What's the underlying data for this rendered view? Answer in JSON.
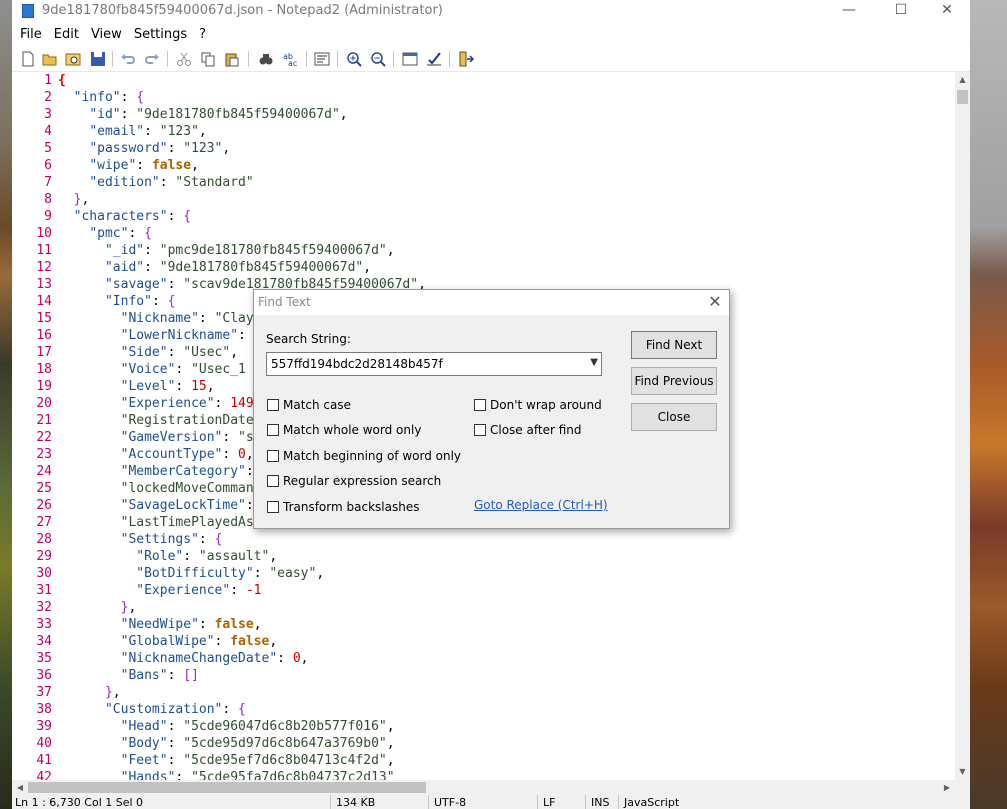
{
  "window": {
    "title": "9de181780fb845f59400067d.json - Notepad2 (Administrator)",
    "controls": {
      "minimize": "—",
      "maximize": "☐",
      "close": "✕"
    }
  },
  "menu": [
    "File",
    "Edit",
    "View",
    "Settings",
    "?"
  ],
  "toolbar": [
    "new-icon",
    "open-icon",
    "browse-icon",
    "save-icon",
    "undo-icon",
    "redo-icon",
    "cut-icon",
    "copy-icon",
    "paste-icon",
    "find-icon",
    "replace-icon",
    "word-wrap-icon",
    "zoom-in-icon",
    "zoom-out-icon",
    "scheme-icon",
    "customize-icon",
    "exit-icon"
  ],
  "editor": {
    "lines": [
      {
        "n": "1",
        "t": "{"
      },
      {
        "n": "2",
        "t": "  \"info\": {"
      },
      {
        "n": "3",
        "t": "    \"id\": \"9de181780fb845f59400067d\","
      },
      {
        "n": "4",
        "t": "    \"email\": \"123\","
      },
      {
        "n": "5",
        "t": "    \"password\": \"123\","
      },
      {
        "n": "6",
        "t": "    \"wipe\": false,"
      },
      {
        "n": "7",
        "t": "    \"edition\": \"Standard\""
      },
      {
        "n": "8",
        "t": "  },"
      },
      {
        "n": "9",
        "t": "  \"characters\": {"
      },
      {
        "n": "10",
        "t": "    \"pmc\": {"
      },
      {
        "n": "11",
        "t": "      \"_id\": \"pmc9de181780fb845f59400067d\","
      },
      {
        "n": "12",
        "t": "      \"aid\": \"9de181780fb845f59400067d\","
      },
      {
        "n": "13",
        "t": "      \"savage\": \"scav9de181780fb845f59400067d\","
      },
      {
        "n": "14",
        "t": "      \"Info\": {"
      },
      {
        "n": "15",
        "t": "        \"Nickname\": \"Clay"
      },
      {
        "n": "16",
        "t": "        \"LowerNickname\":"
      },
      {
        "n": "17",
        "t": "        \"Side\": \"Usec\","
      },
      {
        "n": "18",
        "t": "        \"Voice\": \"Usec_1"
      },
      {
        "n": "19",
        "t": "        \"Level\": 15,"
      },
      {
        "n": "20",
        "t": "        \"Experience\": 149"
      },
      {
        "n": "21",
        "t": "        \"RegistrationDate"
      },
      {
        "n": "22",
        "t": "        \"GameVersion\": \"s"
      },
      {
        "n": "23",
        "t": "        \"AccountType\": 0,"
      },
      {
        "n": "24",
        "t": "        \"MemberCategory\":"
      },
      {
        "n": "25",
        "t": "        \"lockedMoveComman"
      },
      {
        "n": "26",
        "t": "        \"SavageLockTime\":"
      },
      {
        "n": "27",
        "t": "        \"LastTimePlayedAs"
      },
      {
        "n": "28",
        "t": "        \"Settings\": {"
      },
      {
        "n": "29",
        "t": "          \"Role\": \"assault\","
      },
      {
        "n": "30",
        "t": "          \"BotDifficulty\": \"easy\","
      },
      {
        "n": "31",
        "t": "          \"Experience\": -1"
      },
      {
        "n": "32",
        "t": "        },"
      },
      {
        "n": "33",
        "t": "        \"NeedWipe\": false,"
      },
      {
        "n": "34",
        "t": "        \"GlobalWipe\": false,"
      },
      {
        "n": "35",
        "t": "        \"NicknameChangeDate\": 0,"
      },
      {
        "n": "36",
        "t": "        \"Bans\": []"
      },
      {
        "n": "37",
        "t": "      },"
      },
      {
        "n": "38",
        "t": "      \"Customization\": {"
      },
      {
        "n": "39",
        "t": "        \"Head\": \"5cde96047d6c8b20b577f016\","
      },
      {
        "n": "40",
        "t": "        \"Body\": \"5cde95d97d6c8b647a3769b0\","
      },
      {
        "n": "41",
        "t": "        \"Feet\": \"5cde95ef7d6c8b04713c4f2d\","
      },
      {
        "n": "42",
        "t": "        \"Hands\": \"5cde95fa7d6c8b04737c2d13\""
      }
    ]
  },
  "status": {
    "position": "Ln 1 : 6,730    Col 1    Sel 0",
    "size": "134 KB",
    "encoding": "UTF-8",
    "eol": "LF",
    "mode": "INS",
    "lexer": "JavaScript"
  },
  "find_dialog": {
    "title": "Find Text",
    "search_label": "Search String:",
    "search_value": "557ffd194bdc2d28148b457f",
    "options": {
      "match_case": "Match case",
      "match_whole_word": "Match whole word only",
      "match_beginning": "Match beginning of word only",
      "regex": "Regular expression search",
      "transform_backslashes": "Transform backslashes",
      "dont_wrap": "Don't wrap around",
      "close_after_find": "Close after find"
    },
    "buttons": {
      "find_next": "Find Next",
      "find_previous": "Find Previous",
      "close": "Close"
    },
    "goto_replace": "Goto Replace (Ctrl+H)"
  }
}
